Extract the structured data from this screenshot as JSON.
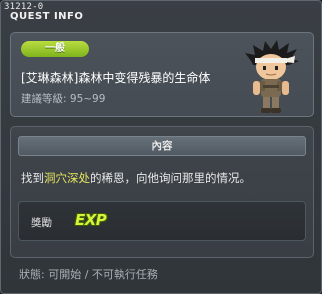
{
  "header": {
    "quest_id": "31212-0",
    "title": "QUEST INFO"
  },
  "quest": {
    "category": "一般",
    "name": "[艾琳森林]森林中变得残暴的生命体",
    "level_label": "建議等級:",
    "level_range": "95~99"
  },
  "content": {
    "section_title": "內容",
    "desc_prefix": "找到",
    "desc_highlight": "洞穴深处",
    "desc_suffix": "的稀恩，向他询问那里的情况。",
    "reward_label": "獎勵",
    "reward_value": "EXP"
  },
  "footer": {
    "status": "狀態: 可開始 / 不可執行任務"
  },
  "colors": {
    "badge_green": "#8cc022",
    "highlight_yellow": "#e8e55e",
    "exp_green": "#d6f53a"
  }
}
